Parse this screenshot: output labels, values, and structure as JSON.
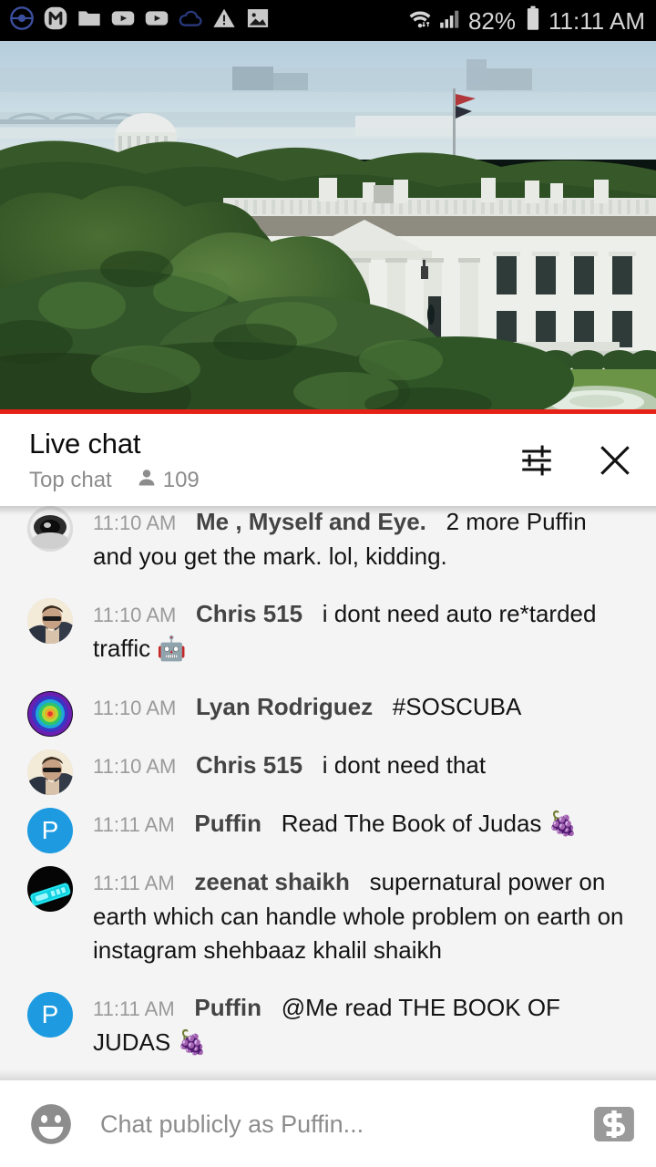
{
  "statusbar": {
    "icons_left": [
      "pokemon-go-icon",
      "m-app-icon",
      "folder-icon",
      "youtube-icon",
      "youtube-icon-2",
      "cloud-icon",
      "warning-icon",
      "image-icon"
    ],
    "wifi_icon": "wifi-icon",
    "signal_icon": "cellular-signal-icon",
    "battery_percent": "82%",
    "battery_icon": "battery-icon",
    "clock": "11:11 AM"
  },
  "player": {
    "name": "live-video-player",
    "progress_percent": 100,
    "progress_color": "#e62117",
    "scene": "White House south lawn live webcam"
  },
  "chat_header": {
    "title": "Live chat",
    "mode": "Top chat",
    "viewer_icon": "person-icon",
    "viewer_count": "109",
    "settings_icon": "settings-sliders-icon",
    "close_icon": "close-icon"
  },
  "messages": [
    {
      "avatar": "avatar-eye",
      "avatar_type": "image",
      "time": "11:10 AM",
      "author": "Me , Myself and Eye.",
      "text": "2 more Puffin and you get the mark. lol, kidding.",
      "emoji": ""
    },
    {
      "avatar": "avatar-chris515",
      "avatar_type": "image",
      "time": "11:10 AM",
      "author": "Chris 515",
      "text": "i dont need auto re*tarded traffic ",
      "emoji": "🤖"
    },
    {
      "avatar": "avatar-lyan",
      "avatar_type": "image",
      "time": "11:10 AM",
      "author": "Lyan Rodriguez",
      "text": "#SOSCUBA",
      "emoji": ""
    },
    {
      "avatar": "avatar-chris515",
      "avatar_type": "image",
      "time": "11:10 AM",
      "author": "Chris 515",
      "text": "i dont need that",
      "emoji": ""
    },
    {
      "avatar": "avatar-puffin",
      "avatar_type": "initial",
      "avatar_initial": "P",
      "avatar_color": "#1e9be0",
      "time": "11:11 AM",
      "author": "Puffin",
      "text": "Read The Book of Judas ",
      "emoji": "🍇"
    },
    {
      "avatar": "avatar-zeenat",
      "avatar_type": "image",
      "time": "11:11 AM",
      "author": "zeenat shaikh",
      "text": "supernatural power on earth which can handle whole problem on earth on instagram shehbaaz khalil shaikh",
      "emoji": ""
    },
    {
      "avatar": "avatar-puffin",
      "avatar_type": "initial",
      "avatar_initial": "P",
      "avatar_color": "#1e9be0",
      "time": "11:11 AM",
      "author": "Puffin",
      "text": "@Me read THE BOOK OF JUDAS ",
      "emoji": "🍇"
    }
  ],
  "input_bar": {
    "emoji_icon": "emoji-smiley-icon",
    "placeholder": "Chat publicly as Puffin...",
    "value": "",
    "superchat_icon": "super-chat-dollar-icon"
  }
}
